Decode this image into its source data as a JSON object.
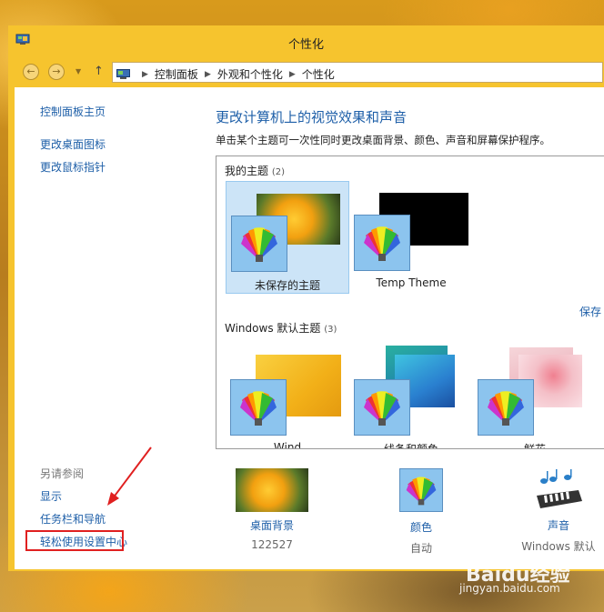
{
  "window": {
    "title": "个性化",
    "app_icon": "control-panel-icon"
  },
  "address_bar": {
    "back_icon": "back-arrow-icon",
    "forward_icon": "forward-arrow-icon",
    "up_icon": "up-arrow-icon",
    "breadcrumbs": [
      "控制面板",
      "外观和个性化",
      "个性化"
    ]
  },
  "sidebar": {
    "home_link": "控制面板主页",
    "links": [
      "更改桌面图标",
      "更改鼠标指针"
    ],
    "see_also_title": "另请参阅",
    "see_also": [
      "显示",
      "任务栏和导航",
      "轻松使用设置中心"
    ]
  },
  "main": {
    "heading": "更改计算机上的视觉效果和声音",
    "description": "单击某个主题可一次性同时更改桌面背景、颜色、声音和屏幕保护程序。",
    "my_themes": {
      "title": "我的主题",
      "count": "(2)",
      "items": [
        "未保存的主题",
        "Temp Theme"
      ]
    },
    "save_link": "保存",
    "default_themes": {
      "title": "Windows 默认主题",
      "count": "(3)",
      "items": [
        "Wind",
        "线条和颜色",
        "鲜花"
      ]
    }
  },
  "bottom": {
    "desktop_background": {
      "label": "桌面背景",
      "sub": "122527"
    },
    "color": {
      "label": "颜色",
      "sub": "自动"
    },
    "sound": {
      "label": "声音",
      "sub": "Windows 默认"
    }
  },
  "watermark": {
    "brand": "Baidu经验",
    "url": "jingyan.baidu.com"
  },
  "colors": {
    "accent_border": "#f6c42e",
    "link": "#1e5fa8",
    "selection": "#cce4f7",
    "highlight_box": "#e02020"
  }
}
